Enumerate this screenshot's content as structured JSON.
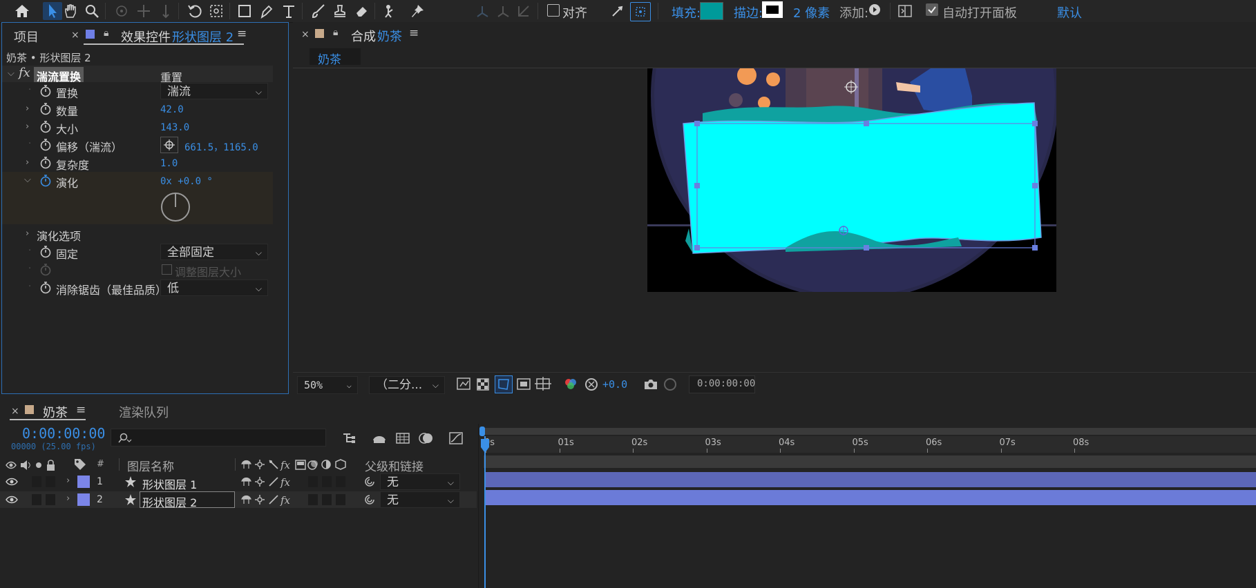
{
  "toolbar": {
    "snap_label": "对齐",
    "fill_label": "填充:",
    "stroke_label": "描边:",
    "stroke_width": "2 像素",
    "add_label": "添加:",
    "auto_open_label": "自动打开面板",
    "workspace_label": "默认",
    "fill_color": "#009a9a",
    "stroke_color": "#ffffff"
  },
  "project_panel": {
    "project_tab": "项目",
    "effects_tab_prefix": "效果控件",
    "effects_tab_layer": "形状图层 2",
    "breadcrumb": "奶茶 • 形状图层 2",
    "effect_name": "湍流置换",
    "reset_label": "重置",
    "properties": [
      {
        "label": "置换",
        "value": "湍流"
      },
      {
        "label": "数量",
        "value": "42.0"
      },
      {
        "label": "大小",
        "value": "143.0"
      },
      {
        "label": "偏移（湍流）",
        "value": "661.5，1165.0"
      },
      {
        "label": "复杂度",
        "value": "1.0"
      },
      {
        "label": "演化",
        "value": "0x +0.0 °"
      },
      {
        "label": "演化选项",
        "value": ""
      },
      {
        "label": "固定",
        "value": "全部固定"
      },
      {
        "label": "调整图层大小",
        "value": ""
      },
      {
        "label": "消除锯齿（最佳品质）",
        "value": "低"
      }
    ]
  },
  "composition_panel": {
    "title_prefix": "合成",
    "comp_name": "奶茶",
    "breadcrumb_tab": "奶茶",
    "zoom": "50%",
    "resolution": "（二分...",
    "exposure": "+0.0",
    "timecode": "0:00:00:00"
  },
  "timeline": {
    "comp_tab": "奶茶",
    "render_queue_tab": "渲染队列",
    "current_time": "0:00:00:00",
    "fps": "00000 (25.00 fps)",
    "search_placeholder": "",
    "col_number": "#",
    "col_layer_name": "图层名称",
    "col_parent": "父级和链接",
    "layers": [
      {
        "number": "1",
        "name": "形状图层 1",
        "parent": "无",
        "color": "#7b85e8"
      },
      {
        "number": "2",
        "name": "形状图层 2",
        "parent": "无",
        "color": "#7b85e8"
      }
    ],
    "ruler": [
      "0s",
      "01s",
      "02s",
      "03s",
      "04s",
      "05s",
      "06s",
      "07s",
      "08s"
    ]
  }
}
